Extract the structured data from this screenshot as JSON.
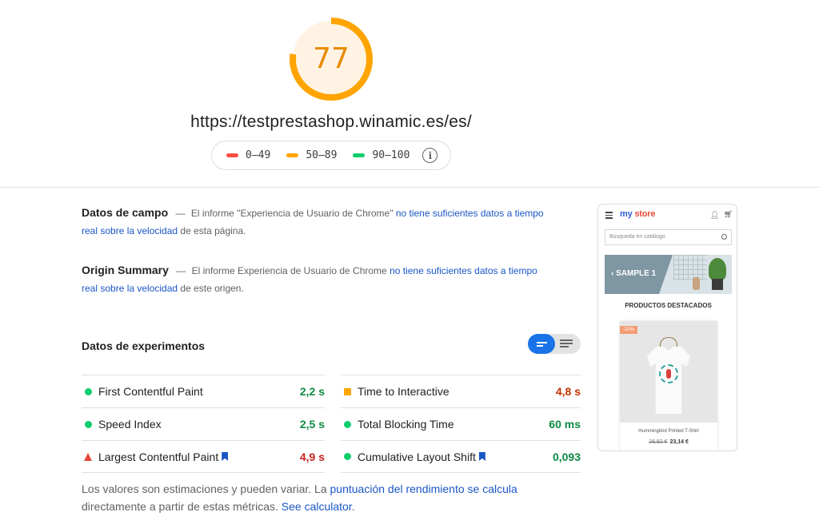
{
  "score": {
    "value": "77",
    "fraction": 0.77,
    "color": "#ffa400"
  },
  "url": "https://testprestashop.winamic.es/es/",
  "legend": [
    {
      "label": "0–49",
      "color": "#ff4e42"
    },
    {
      "label": "50–89",
      "color": "#ffa400"
    },
    {
      "label": "90–100",
      "color": "#0cce6b"
    }
  ],
  "field_data": {
    "heading": "Datos de campo",
    "dash": "—",
    "text_before": "El informe \"Experiencia de Usuario de Chrome\"",
    "link": "no tiene suficientes datos a tiempo real sobre la velocidad",
    "text_after": "de esta página."
  },
  "origin_summary": {
    "heading": "Origin Summary",
    "dash": "—",
    "text_before": "El informe Experiencia de Usuario de Chrome",
    "link": "no tiene suficientes datos a tiempo real sobre la velocidad",
    "text_after": "de este origen."
  },
  "lab": {
    "title": "Datos de experimentos"
  },
  "metrics_left": [
    {
      "name": "First Contentful Paint",
      "value": "2,2 s",
      "status": "good"
    },
    {
      "name": "Speed Index",
      "value": "2,5 s",
      "status": "good"
    },
    {
      "name": "Largest Contentful Paint",
      "value": "4,9 s",
      "status": "poor",
      "bookmark": true
    }
  ],
  "metrics_right": [
    {
      "name": "Time to Interactive",
      "value": "4,8 s",
      "status": "average"
    },
    {
      "name": "Total Blocking Time",
      "value": "60 ms",
      "status": "good"
    },
    {
      "name": "Cumulative Layout Shift",
      "value": "0,093",
      "status": "good",
      "bookmark": true
    }
  ],
  "status_colors": {
    "good": "#0cce6b",
    "average": "#ffa400",
    "poor": "#e8453c",
    "good_text": "#0d8a43",
    "average_text": "#c33300",
    "poor_text": "#c7221f"
  },
  "note": {
    "text_before": "Los valores son estimaciones y pueden variar. La",
    "link1": "puntuación del rendimiento se calcula",
    "text_middle": "directamente a partir de estas métricas.",
    "link2": "See calculator",
    "text_after": "."
  },
  "phone": {
    "logo_my": "my",
    "logo_store": "store",
    "search_placeholder": "Búsqueda en catálogo",
    "banner_text": "‹ SAMPLE 1",
    "section_title": "PRODUCTOS DESTACADOS",
    "badge": "-20%",
    "product_name": "Hummingbird Printed T-Shirt",
    "old_price": "28,92 €",
    "price": "23,14 €"
  }
}
